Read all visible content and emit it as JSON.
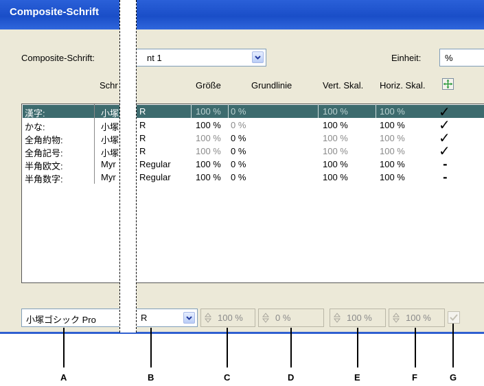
{
  "window": {
    "title": "Composite-Schrift"
  },
  "header": {
    "font_label": "Composite-Schrift:",
    "font_value": "nt 1",
    "unit_label": "Einheit:",
    "unit_value": "%"
  },
  "columns": {
    "schrift": "Schr",
    "size": "Größe",
    "baseline": "Grundlinie",
    "vscale": "Vert. Skal.",
    "hscale": "Horiz. Skal."
  },
  "rows": [
    {
      "name": "漢字:",
      "font": "小塚",
      "style": "R",
      "size": "100 %",
      "baseline": "0 %",
      "vscale": "100 %",
      "hscale": "100 %",
      "mark": "✓"
    },
    {
      "name": "かな:",
      "font": "小塚",
      "style": "R",
      "size": "100 %",
      "baseline": "0 %",
      "vscale": "100 %",
      "hscale": "100 %",
      "mark": "✓"
    },
    {
      "name": "全角約物:",
      "font": "小塚",
      "style": "R",
      "size": "100 %",
      "baseline": "0 %",
      "vscale": "100 %",
      "hscale": "100 %",
      "mark": "✓"
    },
    {
      "name": "全角記号:",
      "font": "小塚",
      "style": "R",
      "size": "100 %",
      "baseline": "0 %",
      "vscale": "100 %",
      "hscale": "100 %",
      "mark": "✓"
    },
    {
      "name": "半角欧文:",
      "font": "Myr",
      "style": "Regular",
      "size": "100 %",
      "baseline": "0 %",
      "vscale": "100 %",
      "hscale": "100 %",
      "mark": "-"
    },
    {
      "name": "半角数字:",
      "font": "Myr",
      "style": "Regular",
      "size": "100 %",
      "baseline": "0 %",
      "vscale": "100 %",
      "hscale": "100 %",
      "mark": "-"
    }
  ],
  "bottom": {
    "font": "小塚ゴシック Pro",
    "style": "R",
    "size": "100 %",
    "baseline": "0 %",
    "vscale": "100 %",
    "hscale": "100 %"
  },
  "pointers": [
    "A",
    "B",
    "C",
    "D",
    "E",
    "F",
    "G"
  ],
  "colors": {
    "titlebar": "#1a4ec8",
    "dialog": "#ece9d8",
    "selected_row": "#3d6b6e"
  }
}
